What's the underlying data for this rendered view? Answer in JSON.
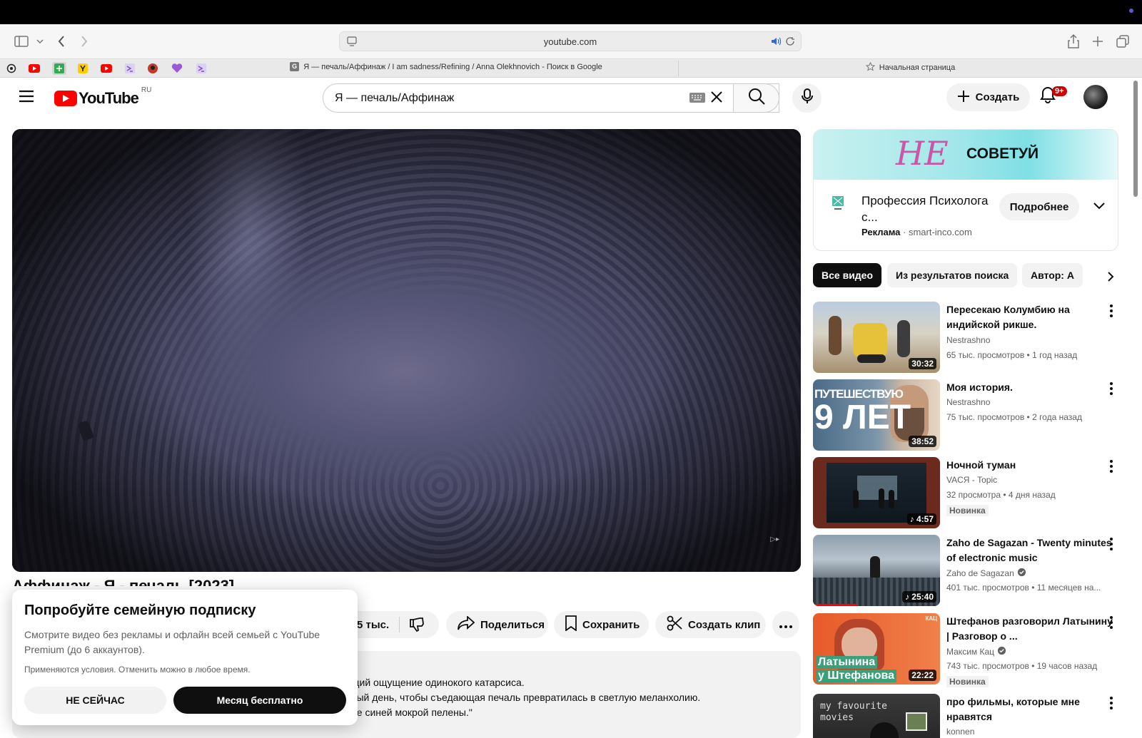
{
  "browser": {
    "url": "youtube.com",
    "active_tab_title": "Я — печаль/Аффинаж / I am sadness/Refining / Anna Olekhnovich - Поиск в Google",
    "second_tab_title": "Начальная страница"
  },
  "header": {
    "logo_text": "YouTube",
    "region": "RU",
    "search_value": "Я — печаль/Аффинаж",
    "create_label": "Создать",
    "notif_badge": "9+"
  },
  "video": {
    "title_peek": "Аффинаж - Я - печаль [2023]",
    "like_count_partial": "5 тыс.",
    "share_label": "Поделиться",
    "save_label": "Сохранить",
    "clip_label": "Создать клип",
    "desc_line1": "щий ощущение одинокого катарсиса.",
    "desc_line2": "вый день, чтобы съедающая печаль превратилась в светлую меланхолию.",
    "desc_line3": "ре синей мокрой пелены.\""
  },
  "popup": {
    "title": "Попробуйте семейную подписку",
    "body": "Смотрите видео без рекламы и офлайн всей семьей с YouTube Premium (до 6 аккаунтов).",
    "terms": "Применяются условия. Отменить можно в любое время.",
    "dismiss_label": "НЕ СЕЙЧАС",
    "accept_label": "Месяц бесплатно"
  },
  "ad": {
    "banner_ne": "НЕ",
    "banner_word": "СОВЕТУЙ",
    "title": "Профессия Психолога с...",
    "label": "Реклама",
    "domain": "smart-inco.com",
    "cta": "Подробнее"
  },
  "chips": [
    "Все видео",
    "Из результатов поиска",
    "Автор: А"
  ],
  "related": [
    {
      "title": "Пересекаю Колумбию на индийской рикше.",
      "channel": "Nestrashno",
      "stats": "65 тыс. просмотров • 1 год назад",
      "duration": "30:32",
      "badge": "",
      "verified": false
    },
    {
      "title": "Моя история.",
      "channel": "Nestrashno",
      "stats": "75 тыс. просмотров • 2 года назад",
      "duration": "38:52",
      "badge": "",
      "verified": false,
      "thumb_text_top": "ПУТЕШЕСТВУЮ",
      "thumb_text_big": "9 ЛЕТ"
    },
    {
      "title": "Ночной туман",
      "channel": "VACЯ - Topic",
      "stats": "32 просмотра • 4 дня назад",
      "duration": "4:57",
      "badge": "Новинка",
      "verified": false
    },
    {
      "title": "Zaho de Sagazan - Twenty minutes of electronic music",
      "channel": "Zaho de Sagazan",
      "stats": "401 тыс. просмотров • 11 месяцев на...",
      "duration": "25:40",
      "badge": "",
      "verified": true
    },
    {
      "title": "Штефанов разговорил Латынину | Разговор о ...",
      "channel": "Максим Кац",
      "stats": "743 тыс. просмотров • 19 часов назад",
      "duration": "22:22",
      "badge": "Новинка",
      "verified": true,
      "thumb_text_top": "Латынина",
      "thumb_text_big": "у Штефанова",
      "thumb_corner": "КАЦ"
    },
    {
      "title": "про фильмы, которые мне нравятся",
      "channel": "konnen",
      "stats": "",
      "duration": "",
      "badge": "",
      "verified": false,
      "thumb_text_top": "my favourite",
      "thumb_text_big": "movies"
    }
  ],
  "colors": {
    "youtube_red": "#ff0000",
    "chip_selected": "#0f0f0f",
    "badge_red": "#cc0000"
  }
}
